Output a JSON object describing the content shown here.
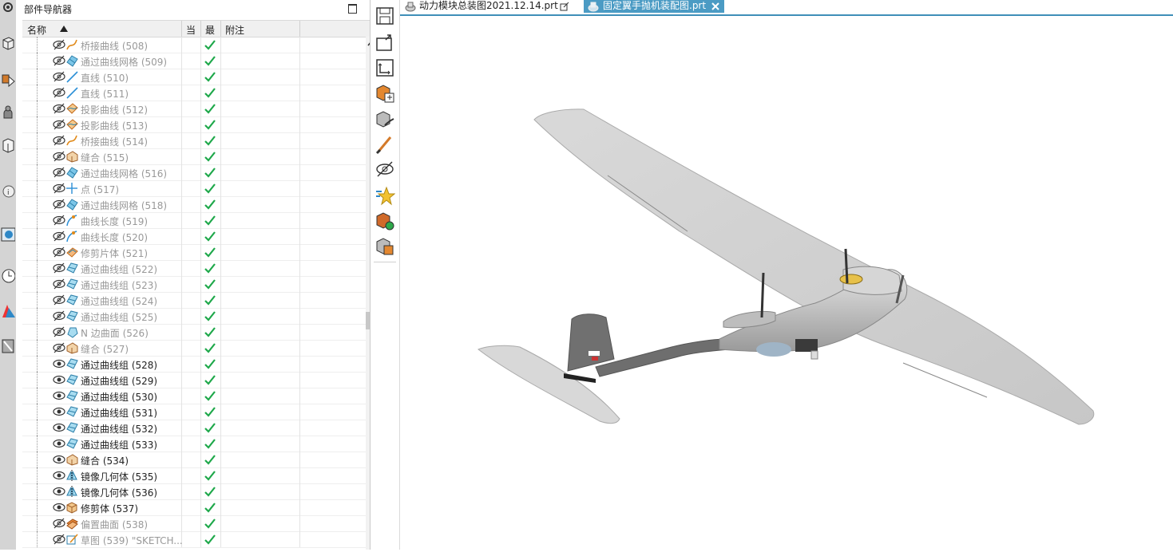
{
  "navigator": {
    "title": "部件导航器",
    "columns": {
      "name": "名称",
      "current": "当",
      "latest": "最",
      "comment": "附注"
    },
    "rows": [
      {
        "label": "桥接曲线 (508)",
        "icon": "bridge-curve-icon",
        "visible": false
      },
      {
        "label": "通过曲线网格 (509)",
        "icon": "curve-mesh-icon",
        "visible": false
      },
      {
        "label": "直线 (510)",
        "icon": "line-icon",
        "visible": false
      },
      {
        "label": "直线 (511)",
        "icon": "line-icon",
        "visible": false
      },
      {
        "label": "投影曲线 (512)",
        "icon": "project-curve-icon",
        "visible": false
      },
      {
        "label": "投影曲线 (513)",
        "icon": "project-curve-icon",
        "visible": false
      },
      {
        "label": "桥接曲线 (514)",
        "icon": "bridge-curve-icon",
        "visible": false
      },
      {
        "label": "缝合 (515)",
        "icon": "sew-icon",
        "visible": false
      },
      {
        "label": "通过曲线网格 (516)",
        "icon": "curve-mesh-icon",
        "visible": false
      },
      {
        "label": "点 (517)",
        "icon": "point-icon",
        "visible": false
      },
      {
        "label": "通过曲线网格 (518)",
        "icon": "curve-mesh-icon",
        "visible": false
      },
      {
        "label": "曲线长度 (519)",
        "icon": "curve-length-icon",
        "visible": false
      },
      {
        "label": "曲线长度 (520)",
        "icon": "curve-length-icon",
        "visible": false
      },
      {
        "label": "修剪片体 (521)",
        "icon": "trim-sheet-icon",
        "visible": false
      },
      {
        "label": "通过曲线组 (522)",
        "icon": "through-curves-icon",
        "visible": false
      },
      {
        "label": "通过曲线组 (523)",
        "icon": "through-curves-icon",
        "visible": false
      },
      {
        "label": "通过曲线组 (524)",
        "icon": "through-curves-icon",
        "visible": false
      },
      {
        "label": "通过曲线组 (525)",
        "icon": "through-curves-icon",
        "visible": false
      },
      {
        "label": "N 边曲面 (526)",
        "icon": "n-sided-surface-icon",
        "visible": false
      },
      {
        "label": "缝合 (527)",
        "icon": "sew-icon",
        "visible": false
      },
      {
        "label": "通过曲线组 (528)",
        "icon": "through-curves-icon",
        "visible": true
      },
      {
        "label": "通过曲线组 (529)",
        "icon": "through-curves-icon",
        "visible": true
      },
      {
        "label": "通过曲线组 (530)",
        "icon": "through-curves-icon",
        "visible": true
      },
      {
        "label": "通过曲线组 (531)",
        "icon": "through-curves-icon",
        "visible": true
      },
      {
        "label": "通过曲线组 (532)",
        "icon": "through-curves-icon",
        "visible": true
      },
      {
        "label": "通过曲线组 (533)",
        "icon": "through-curves-icon",
        "visible": true
      },
      {
        "label": "缝合 (534)",
        "icon": "sew-icon",
        "visible": true
      },
      {
        "label": "镜像几何体 (535)",
        "icon": "mirror-geometry-icon",
        "visible": true
      },
      {
        "label": "镜像几何体 (536)",
        "icon": "mirror-geometry-icon",
        "visible": true
      },
      {
        "label": "修剪体 (537)",
        "icon": "trim-body-icon",
        "visible": true
      },
      {
        "label": "偏置曲面 (538)",
        "icon": "offset-surface-icon",
        "visible": false
      },
      {
        "label": "草图 (539) \"SKETCH...",
        "icon": "sketch-icon",
        "visible": false
      }
    ]
  },
  "tabs": [
    {
      "label": "动力模块总装图2021.12.14.prt",
      "active": false
    },
    {
      "label": "固定翼手抛机装配图.prt",
      "active": true
    }
  ],
  "toolbar": [
    "save-icon",
    "open-icon",
    "export-icon",
    "assembly-add-icon",
    "assembly-edit-icon",
    "paint-brush-icon",
    "hide-icon",
    "favorite-icon",
    "assembly-green-icon",
    "assembly-orange-icon"
  ],
  "resource_bar": [
    "assembly-nav-icon",
    "constraint-nav-icon",
    "part-nav-icon",
    "reuse-library-icon",
    "info-icon",
    "web-browser-icon",
    "history-icon",
    "palette-icon",
    "role-icon",
    "system-scene-icon"
  ],
  "colors": {
    "accent": "#4b9bc4",
    "check": "#1ea84a"
  }
}
